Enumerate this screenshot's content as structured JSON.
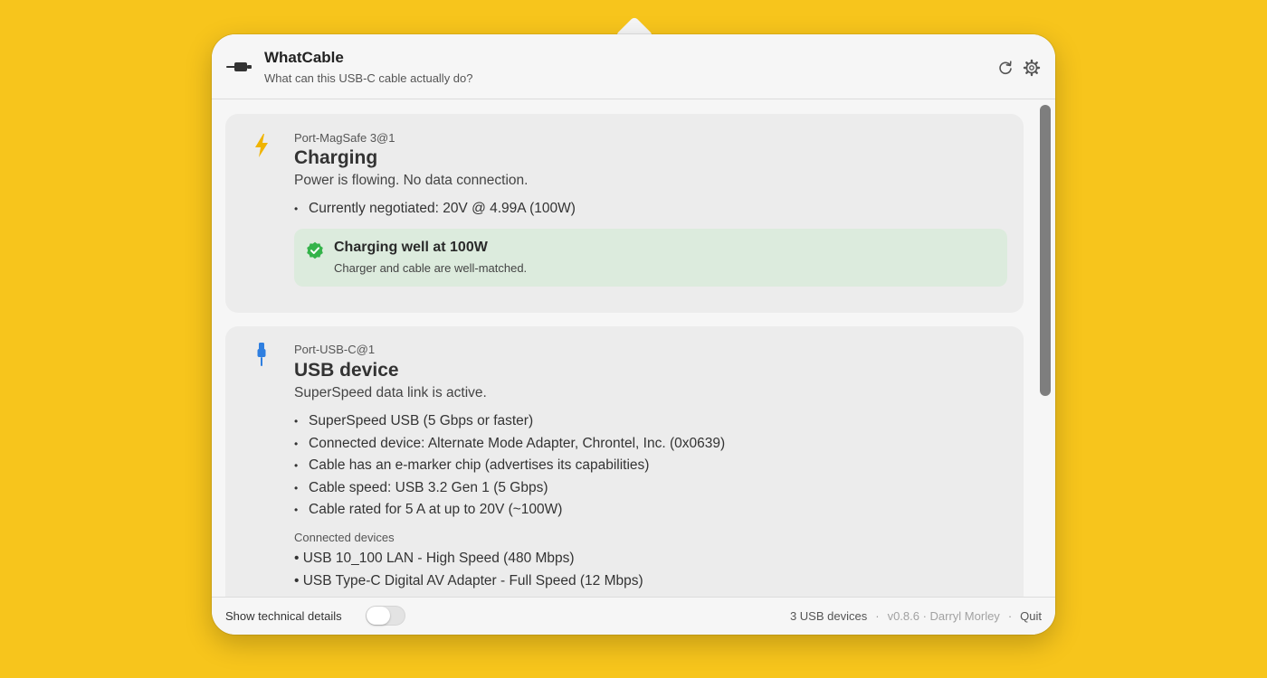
{
  "header": {
    "title": "WhatCable",
    "subtitle": "What can this USB-C cable actually do?"
  },
  "charging_card": {
    "port": "Port-MagSafe 3@1",
    "title": "Charging",
    "description": "Power is flowing. No data connection.",
    "bullets": [
      "Currently negotiated: 20V @ 4.99A (100W)"
    ],
    "status": {
      "title": "Charging well at 100W",
      "description": "Charger and cable are well-matched."
    }
  },
  "usb_card": {
    "port": "Port-USB-C@1",
    "title": "USB device",
    "description": "SuperSpeed data link is active.",
    "bullets": [
      "SuperSpeed USB (5 Gbps or faster)",
      "Connected device: Alternate Mode Adapter, Chrontel, Inc. (0x0639)",
      "Cable has an e-marker chip (advertises its capabilities)",
      "Cable speed: USB 3.2 Gen 1 (5 Gbps)",
      "Cable rated for 5 A at up to 20V (~100W)"
    ],
    "connected_heading": "Connected devices",
    "connected_devices": [
      "• USB 10_100 LAN - High Speed (480 Mbps)",
      "• USB Type-C Digital AV Adapter - Full Speed (12 Mbps)"
    ]
  },
  "footer": {
    "tech_details_label": "Show technical details",
    "tech_details_on": false,
    "usb_count": "3 USB devices",
    "separator": "·",
    "version_author": "v0.8.6 · Darryl Morley",
    "quit_label": "Quit"
  },
  "icons": {
    "app": "cable-plug-icon",
    "refresh": "refresh-icon",
    "settings": "gear-icon",
    "charging": "lightning-bolt-icon",
    "usb": "usb-plug-icon",
    "status": "checkmark-badge-icon"
  },
  "colors": {
    "background": "#F7C51C",
    "bolt": "#F0B400",
    "usb_icon": "#2F7FE0",
    "status_bg": "#DCEBDD",
    "status_check": "#34B34A"
  }
}
